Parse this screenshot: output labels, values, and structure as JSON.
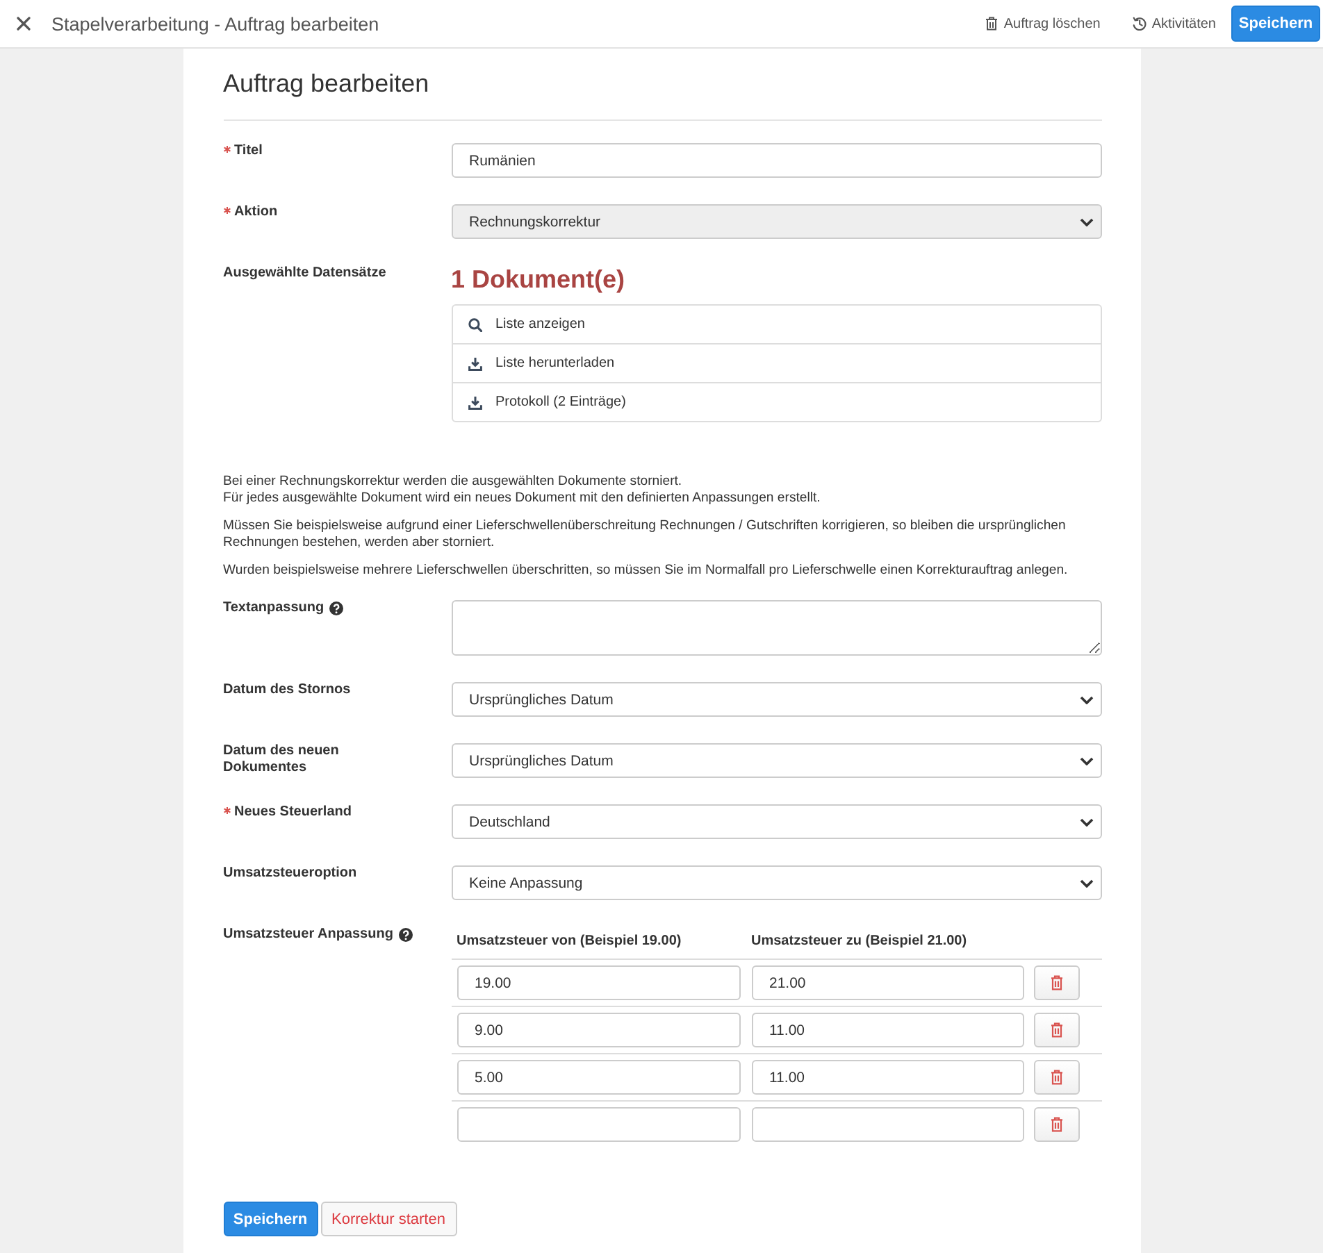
{
  "header": {
    "title": "Stapelverarbeitung - Auftrag bearbeiten",
    "actions": [
      {
        "kind": "delete",
        "label": "Auftrag löschen"
      },
      {
        "kind": "history",
        "label": "Aktivitäten"
      }
    ],
    "save_button": "Speichern"
  },
  "form": {
    "title": "Auftrag bearbeiten",
    "fields": [
      {
        "kind": "text",
        "label": "Titel",
        "required": true,
        "help": false,
        "value": "Rumänien"
      },
      {
        "kind": "select",
        "label": "Aktion",
        "required": true,
        "help": false,
        "value": "Rechnungskorrektur",
        "disabled": true
      },
      {
        "kind": "records",
        "label": "Ausgewählte Datensätze",
        "required": false,
        "help": false,
        "count": "1 Dokument(e)",
        "links": [
          {
            "kind": "search",
            "label": "Liste anzeigen"
          },
          {
            "kind": "download",
            "label": "Liste herunterladen"
          },
          {
            "kind": "download",
            "label": "Protokoll (2 Einträge)"
          }
        ]
      },
      {
        "kind": "info",
        "paragraphs": [
          [
            "Bei einer Rechnungskorrektur werden die ausgewählten Dokumente storniert.",
            "Für jedes ausgewählte Dokument wird ein neues Dokument mit den definierten Anpassungen erstellt."
          ],
          [
            "Müssen Sie beispielsweise aufgrund einer Lieferschwellenüberschreitung Rechnungen / Gutschriften korrigieren, so bleiben die ursprünglichen Rechnungen bestehen, werden aber storniert."
          ],
          [
            "Wurden beispielsweise mehrere Lieferschwellen überschritten, so müssen Sie im Normalfall pro Lieferschwelle einen Korrekturauftrag anlegen."
          ]
        ]
      },
      {
        "kind": "textarea",
        "label": "Textanpassung",
        "required": false,
        "help": true
      },
      {
        "kind": "select",
        "label": "Datum des Stornos",
        "required": false,
        "help": false,
        "value": "Ursprüngliches Datum",
        "disabled": false
      },
      {
        "kind": "select",
        "label": "Datum des neuen Dokumentes",
        "required": false,
        "help": false,
        "value": "Ursprüngliches Datum",
        "disabled": false
      },
      {
        "kind": "select",
        "label": "Neues Steuerland",
        "required": true,
        "help": false,
        "value": "Deutschland",
        "disabled": false
      },
      {
        "kind": "select",
        "label": "Umsatzsteueroption",
        "required": false,
        "help": false,
        "value": "Keine Anpassung",
        "disabled": false
      },
      {
        "kind": "tax_table",
        "label": "Umsatzsteuer Anpassung",
        "required": false,
        "help": true,
        "columns": [
          "Umsatzsteuer von (Beispiel 19.00)",
          "Umsatzsteuer zu (Beispiel 21.00)"
        ],
        "rows": [
          {
            "from": "19.00",
            "to": "21.00"
          },
          {
            "from": "9.00",
            "to": "11.00"
          },
          {
            "from": "5.00",
            "to": "11.00"
          },
          {}
        ]
      }
    ]
  },
  "buttons": [
    {
      "kind": "primary",
      "label": "Speichern"
    },
    {
      "kind": "danger",
      "label": "Korrektur starten"
    }
  ]
}
